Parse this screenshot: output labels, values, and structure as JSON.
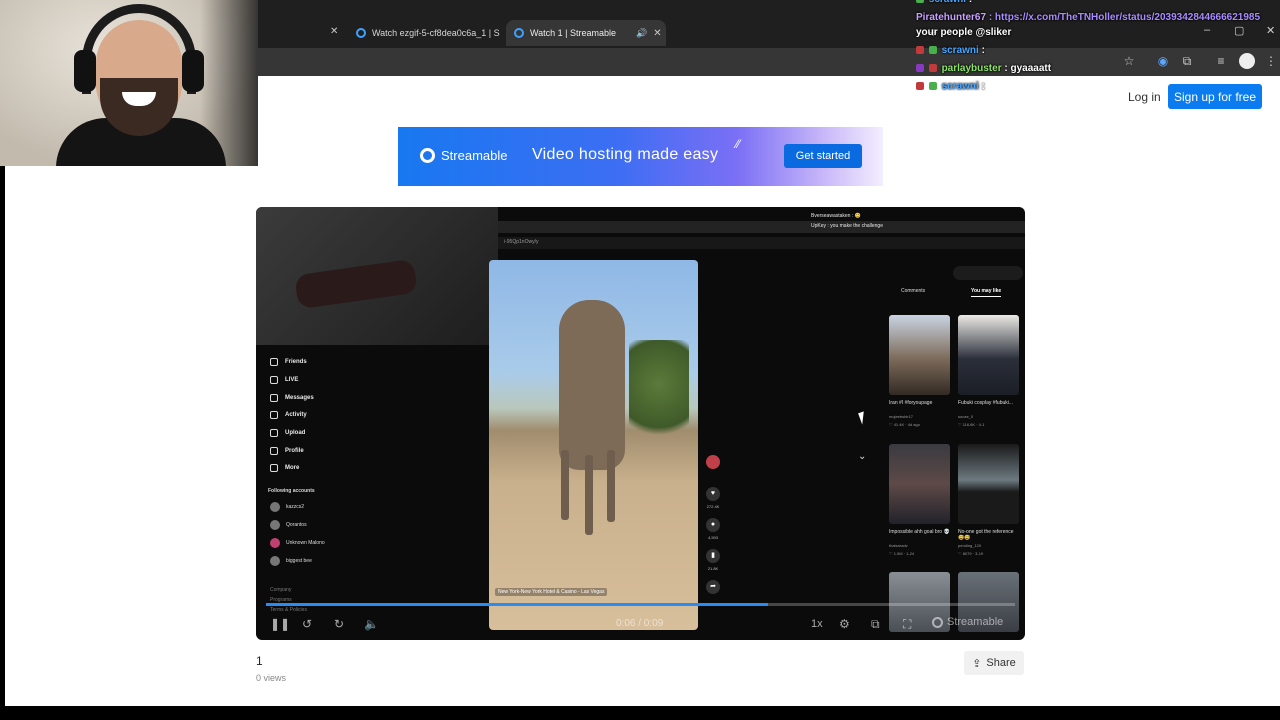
{
  "browser": {
    "tabs": [
      {
        "title": "Watch ezgif-5-cf8dea0c6a_1 | S"
      },
      {
        "title": "Watch 1 | Streamable"
      }
    ],
    "new_tab": "+",
    "window_controls": {
      "minimize": "–",
      "maximize": "▢",
      "close": "✕"
    }
  },
  "header": {
    "login": "Log in",
    "signup": "Sign up for free"
  },
  "ad": {
    "brand": "Streamable",
    "tagline": "Video hosting made easy",
    "cta": "Get started"
  },
  "player": {
    "time": "0:06 / 0:09",
    "speed": "1x",
    "watermark": "Streamable",
    "progress_fraction": 0.67,
    "embedded": {
      "url_fragment": "i-95Qp1nOwy/y",
      "sidebar": [
        "Friends",
        "LIVE",
        "Messages",
        "Activity",
        "Upload",
        "Profile",
        "More"
      ],
      "following_heading": "Following accounts",
      "following": [
        "kazzcs2",
        "Qorantos",
        "Unknown Malono",
        "biggest bee"
      ],
      "footer": [
        "Company",
        "Programs",
        "Terms & Policies"
      ],
      "caption": "New York-New York Hotel & Casino - Las Vegas",
      "like_count": "272.4K",
      "comment_count": "4,593",
      "save_count": "21.8K",
      "reco_tabs": [
        "Comments",
        "You may like"
      ],
      "reco": [
        {
          "caption": "Iran #I #foryoupage",
          "author": "mojeebshir17",
          "meta": "♡ 41.4K · 4d ago"
        },
        {
          "caption": "Fubuki cosplay #fubuki...",
          "author": "sooze_0",
          "meta": "♡ 116.6K · 4-1"
        },
        {
          "caption": "Impossible ahh goal bro 💀",
          "author": "thatsreadv",
          "meta": "♡ 1.0M · 1-24"
        },
        {
          "caption": "No-one got the reference 😅😅",
          "author": "pending_120",
          "meta": "♡ 8079 · 3-19"
        }
      ],
      "chat": [
        "Bverseawastaken : 😊",
        "UpKey : you make the challenge"
      ]
    }
  },
  "video": {
    "title": "1",
    "views": "0 views",
    "share": "Share"
  },
  "chat": [
    {
      "user": "scrawni",
      "text": ":",
      "color": "#4aa6ff"
    },
    {
      "user": "Piratehunter67",
      "text": ": https://x.com/TheTNHoller/status/2039342844666621985",
      "color": "#c8a0ff",
      "link_color": "#a98cff"
    },
    {
      "user": "",
      "text": "your people @sliker",
      "color": "#ffffff"
    },
    {
      "user": "scrawni",
      "text": ":",
      "color": "#4aa6ff"
    },
    {
      "user": "parlaybuster",
      "text": ": gyaaaatt",
      "color": "#8fe36b"
    },
    {
      "user": "scrawni",
      "text": ":",
      "color": "#4aa6ff"
    }
  ]
}
